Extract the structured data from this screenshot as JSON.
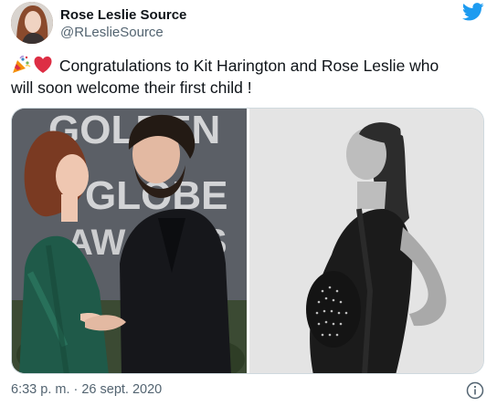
{
  "tweet": {
    "author_name": "Rose Leslie Source",
    "author_handle": "@RLeslieSource",
    "emojis": [
      "party-popper-icon",
      "red-heart-icon"
    ],
    "text_line1": "Congratulations to Kit Harington and Rose Leslie who",
    "text_line2": "will soon welcome their first child !",
    "photo_left_text": [
      "GOLDEN",
      "GLOBE",
      "AWARDS"
    ],
    "timestamp": "6:33 p. m. · 26 sept. 2020"
  },
  "colors": {
    "text": "#0f1419",
    "secondary": "#536471",
    "twitter_blue": "#1d9bf0",
    "border": "#cfd9de"
  },
  "icons": [
    "twitter-bird-icon",
    "info-icon"
  ]
}
